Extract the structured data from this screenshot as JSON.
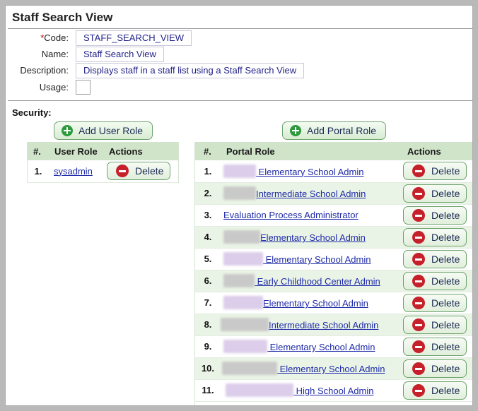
{
  "page": {
    "title": "Staff Search View"
  },
  "form": {
    "code": {
      "required_mark": "*",
      "label": "Code:",
      "value": "STAFF_SEARCH_VIEW"
    },
    "name": {
      "label": "Name:",
      "value": "Staff Search View"
    },
    "description": {
      "label": "Description:",
      "value": "Displays staff in a staff list using a Staff Search View"
    },
    "usage": {
      "label": "Usage:",
      "checked": false
    }
  },
  "security": {
    "label": "Security:",
    "add_user_role_label": "Add User Role",
    "add_portal_role_label": "Add Portal Role",
    "user_roles": {
      "headers": [
        "#.",
        "User Role",
        "Actions"
      ],
      "rows": [
        {
          "num": "1.",
          "role": "sysadmin",
          "action": "Delete"
        }
      ]
    },
    "portal_roles": {
      "headers": [
        "#.",
        "Portal Role",
        "Actions"
      ],
      "rows": [
        {
          "num": "1.",
          "redacted": true,
          "role": " Elementary School Admin",
          "action": "Delete"
        },
        {
          "num": "2.",
          "redacted": true,
          "role": "Intermediate School Admin",
          "action": "Delete"
        },
        {
          "num": "3.",
          "redacted": false,
          "role": "Evaluation Process Administrator",
          "action": "Delete"
        },
        {
          "num": "4.",
          "redacted": true,
          "role": "Elementary School Admin",
          "action": "Delete"
        },
        {
          "num": "5.",
          "redacted": true,
          "role": " Elementary School Admin",
          "action": "Delete"
        },
        {
          "num": "6.",
          "redacted": true,
          "role": " Early Childhood Center Admin",
          "action": "Delete"
        },
        {
          "num": "7.",
          "redacted": true,
          "role": "Elementary School Admin",
          "action": "Delete"
        },
        {
          "num": "8.",
          "redacted": true,
          "role": "Intermediate School Admin",
          "action": "Delete"
        },
        {
          "num": "9.",
          "redacted": true,
          "role": " Elementary School Admin",
          "action": "Delete"
        },
        {
          "num": "10.",
          "redacted": true,
          "role": " Elementary School Admin",
          "action": "Delete"
        },
        {
          "num": "11.",
          "redacted": true,
          "role": " High School Admin",
          "action": "Delete"
        }
      ]
    }
  },
  "icons": {
    "add": "plus-circle-icon",
    "delete": "minus-circle-icon"
  },
  "colors": {
    "header_bg": "#cfe4c9",
    "row_alt_bg": "#eaf4e6",
    "link": "#1e2aa8",
    "delete_icon": "#c6202a",
    "add_icon": "#2e9a3e",
    "redaction_gray": "#c8c8c8",
    "redaction_purple": "#d8c8e6"
  }
}
